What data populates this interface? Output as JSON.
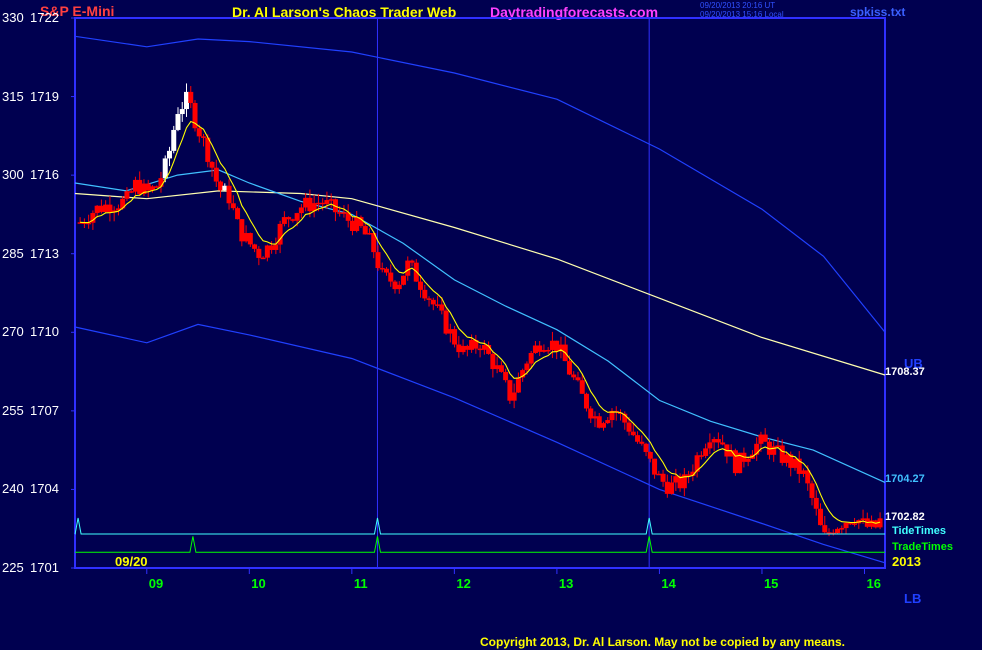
{
  "header": {
    "symbol": "S&P E-Mini",
    "title": "Dr. Al Larson's Chaos Trader Web",
    "site": "Daytradingforecasts.com",
    "timestamp_ut": "09/20/2013 20:16 UT",
    "timestamp_local": "09/20/2013 15:16 Local",
    "filename": "spkiss.txt"
  },
  "footer": {
    "copyright": "Copyright 2013, Dr. Al Larson. May not be copied by any means."
  },
  "colors": {
    "background": "#000050",
    "frame": "#3030ff",
    "bar_up": "#ffffff",
    "bar_down": "#ff0000",
    "ema_fast": "#ffff00",
    "ema_mid": "#40c0ff",
    "ema_slow": "#ffffb0",
    "bands": "#2040ff",
    "tide": "#40ffff",
    "trade": "#00ff00"
  },
  "chart_data": {
    "type": "candlestick",
    "y_axis": {
      "ticks": [
        {
          "left": "330",
          "right": "1722",
          "price": 1722
        },
        {
          "left": "315",
          "right": "1719",
          "price": 1719
        },
        {
          "left": "300",
          "right": "1716",
          "price": 1716
        },
        {
          "left": "285",
          "right": "1713",
          "price": 1713
        },
        {
          "left": "270",
          "right": "1710",
          "price": 1710
        },
        {
          "left": "255",
          "right": "1707",
          "price": 1707
        },
        {
          "left": "240",
          "right": "1704",
          "price": 1704
        },
        {
          "left": "225",
          "right": "1701",
          "price": 1701
        }
      ],
      "range": [
        1701,
        1722
      ]
    },
    "x_axis": {
      "date_label": "09/20",
      "year_label": "2013",
      "range": [
        8.3,
        16.2
      ],
      "hour_ticks": [
        {
          "label": "09",
          "hour": 9
        },
        {
          "label": "10",
          "hour": 10
        },
        {
          "label": "11",
          "hour": 11
        },
        {
          "label": "12",
          "hour": 12
        },
        {
          "label": "13",
          "hour": 13
        },
        {
          "label": "14",
          "hour": 14
        },
        {
          "label": "15",
          "hour": 15
        },
        {
          "label": "16",
          "hour": 16
        }
      ]
    },
    "vertical_markers": [
      11.25,
      13.9
    ],
    "price_path": [
      [
        8.35,
        1714.2
      ],
      [
        8.5,
        1714.7
      ],
      [
        8.65,
        1714.9
      ],
      [
        8.8,
        1715.0
      ],
      [
        8.9,
        1715.7
      ],
      [
        9.0,
        1715.3
      ],
      [
        9.1,
        1715.6
      ],
      [
        9.2,
        1716.5
      ],
      [
        9.3,
        1718.5
      ],
      [
        9.4,
        1718.9
      ],
      [
        9.5,
        1717.8
      ],
      [
        9.6,
        1716.8
      ],
      [
        9.7,
        1715.5
      ],
      [
        9.8,
        1715.2
      ],
      [
        9.9,
        1713.9
      ],
      [
        10.0,
        1713.4
      ],
      [
        10.1,
        1713.0
      ],
      [
        10.2,
        1713.3
      ],
      [
        10.35,
        1714.3
      ],
      [
        10.5,
        1714.8
      ],
      [
        10.7,
        1715.0
      ],
      [
        10.85,
        1714.6
      ],
      [
        11.0,
        1714.2
      ],
      [
        11.1,
        1713.9
      ],
      [
        11.2,
        1713.3
      ],
      [
        11.3,
        1712.1
      ],
      [
        11.45,
        1711.9
      ],
      [
        11.55,
        1712.6
      ],
      [
        11.7,
        1711.7
      ],
      [
        11.85,
        1710.7
      ],
      [
        12.0,
        1709.7
      ],
      [
        12.1,
        1709.2
      ],
      [
        12.25,
        1709.6
      ],
      [
        12.4,
        1708.7
      ],
      [
        12.55,
        1707.5
      ],
      [
        12.7,
        1708.9
      ],
      [
        12.85,
        1709.7
      ],
      [
        13.0,
        1709.5
      ],
      [
        13.1,
        1708.7
      ],
      [
        13.25,
        1707.5
      ],
      [
        13.4,
        1706.6
      ],
      [
        13.55,
        1707.1
      ],
      [
        13.7,
        1706.4
      ],
      [
        13.85,
        1705.4
      ],
      [
        14.0,
        1704.4
      ],
      [
        14.1,
        1704.1
      ],
      [
        14.25,
        1704.3
      ],
      [
        14.4,
        1705.5
      ],
      [
        14.5,
        1706.2
      ],
      [
        14.6,
        1705.9
      ],
      [
        14.75,
        1704.9
      ],
      [
        14.9,
        1705.6
      ],
      [
        15.0,
        1705.8
      ],
      [
        15.1,
        1705.5
      ],
      [
        15.25,
        1705.1
      ],
      [
        15.4,
        1704.6
      ],
      [
        15.5,
        1703.5
      ],
      [
        15.6,
        1702.1
      ],
      [
        15.7,
        1702.6
      ],
      [
        15.8,
        1702.8
      ],
      [
        15.9,
        1703.0
      ],
      [
        16.0,
        1702.6
      ],
      [
        16.1,
        1702.5
      ],
      [
        16.15,
        1702.8
      ]
    ],
    "overlays": [
      {
        "name": "UB",
        "color": "#2040ff",
        "points": [
          [
            8.3,
            1721.3
          ],
          [
            9.0,
            1720.9
          ],
          [
            9.5,
            1721.2
          ],
          [
            10.0,
            1721.1
          ],
          [
            11.0,
            1720.7
          ],
          [
            12.0,
            1719.9
          ],
          [
            13.0,
            1718.9
          ],
          [
            14.0,
            1717.0
          ],
          [
            15.0,
            1714.7
          ],
          [
            15.6,
            1712.9
          ],
          [
            16.2,
            1710.0
          ]
        ]
      },
      {
        "name": "EMA slow",
        "color": "#ffffb0",
        "points": [
          [
            8.3,
            1715.3
          ],
          [
            9.0,
            1715.1
          ],
          [
            9.7,
            1715.4
          ],
          [
            10.5,
            1715.3
          ],
          [
            11.0,
            1715.1
          ],
          [
            12.0,
            1714.0
          ],
          [
            13.0,
            1712.8
          ],
          [
            14.0,
            1711.3
          ],
          [
            15.0,
            1709.8
          ],
          [
            16.2,
            1708.37
          ]
        ]
      },
      {
        "name": "EMA mid",
        "color": "#40c0ff",
        "points": [
          [
            8.3,
            1715.7
          ],
          [
            8.8,
            1715.4
          ],
          [
            9.3,
            1716.0
          ],
          [
            9.7,
            1716.2
          ],
          [
            10.0,
            1715.7
          ],
          [
            10.5,
            1715.0
          ],
          [
            11.0,
            1714.5
          ],
          [
            11.5,
            1713.4
          ],
          [
            12.0,
            1712.0
          ],
          [
            12.5,
            1711.0
          ],
          [
            13.0,
            1710.1
          ],
          [
            13.5,
            1708.9
          ],
          [
            14.0,
            1707.4
          ],
          [
            14.5,
            1706.6
          ],
          [
            15.0,
            1706.0
          ],
          [
            15.5,
            1705.5
          ],
          [
            16.2,
            1704.27
          ]
        ]
      },
      {
        "name": "LB",
        "color": "#2040ff",
        "points": [
          [
            8.3,
            1710.2
          ],
          [
            9.0,
            1709.6
          ],
          [
            9.5,
            1710.3
          ],
          [
            10.0,
            1709.9
          ],
          [
            11.0,
            1709.0
          ],
          [
            12.0,
            1707.5
          ],
          [
            13.0,
            1705.8
          ],
          [
            14.0,
            1704.0
          ],
          [
            15.0,
            1702.7
          ],
          [
            15.6,
            1701.9
          ],
          [
            16.2,
            1701.2
          ]
        ]
      }
    ],
    "right_labels": {
      "ub": "UB",
      "lb": "LB",
      "slow_value": "1708.37",
      "mid_value": "1704.27",
      "last_value": "1702.82",
      "tide": "TideTimes",
      "trade": "TradeTimes"
    },
    "tide_times": {
      "baseline_price": 1702.3,
      "spikes": [
        8.33,
        11.25,
        13.9
      ]
    },
    "trade_times": {
      "baseline_price": 1701.6,
      "spikes": [
        9.45,
        11.25,
        13.9
      ]
    }
  }
}
